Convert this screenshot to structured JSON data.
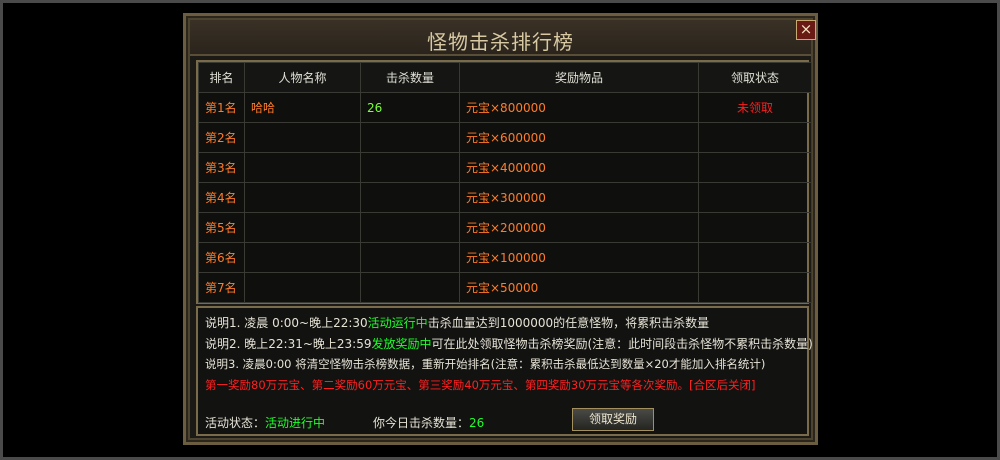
{
  "window": {
    "title": "怪物击杀排行榜",
    "close_label": "×"
  },
  "table": {
    "headers": [
      "排名",
      "人物名称",
      "击杀数量",
      "奖励物品",
      "领取状态"
    ],
    "rows": [
      {
        "rank": "第1名",
        "name": "哈哈",
        "kills": "26",
        "reward": "元宝×800000",
        "status": "未领取"
      },
      {
        "rank": "第2名",
        "name": "",
        "kills": "",
        "reward": "元宝×600000",
        "status": ""
      },
      {
        "rank": "第3名",
        "name": "",
        "kills": "",
        "reward": "元宝×400000",
        "status": ""
      },
      {
        "rank": "第4名",
        "name": "",
        "kills": "",
        "reward": "元宝×300000",
        "status": ""
      },
      {
        "rank": "第5名",
        "name": "",
        "kills": "",
        "reward": "元宝×200000",
        "status": ""
      },
      {
        "rank": "第6名",
        "name": "",
        "kills": "",
        "reward": "元宝×100000",
        "status": ""
      },
      {
        "rank": "第7名",
        "name": "",
        "kills": "",
        "reward": "元宝×50000",
        "status": ""
      }
    ]
  },
  "info": {
    "line1_a": "说明1. 凌晨 0:00~晚上22:30",
    "line1_b": "活动运行中",
    "line1_c": "击杀血量达到1000000的任意怪物，将累积击杀数量",
    "line2_a": "说明2. 晚上22:31~晚上23:59",
    "line2_b": "发放奖励中",
    "line2_c": "可在此处领取怪物击杀榜奖励(注意：此时间段击杀怪物不累积击杀数量)",
    "line3": "说明3. 凌晨0:00 将清空怪物击杀榜数据，重新开始排名(注意：累积击杀最低达到数量×20才能加入排名统计)",
    "line4": "第一奖励80万元宝、第二奖励60万元宝、第三奖励40万元宝、第四奖励30万元宝等各次奖励。[合区后关闭]",
    "status_label": "活动状态：",
    "status_value": "活动进行中",
    "kill_label": "你今日击杀数量：",
    "kill_value": "26",
    "claim_button": "领取奖励"
  },
  "colors": {
    "orange": "#ff7c2a",
    "green": "#1fff2a",
    "red": "#ff2020",
    "gold_border": "#7a6c4b"
  }
}
